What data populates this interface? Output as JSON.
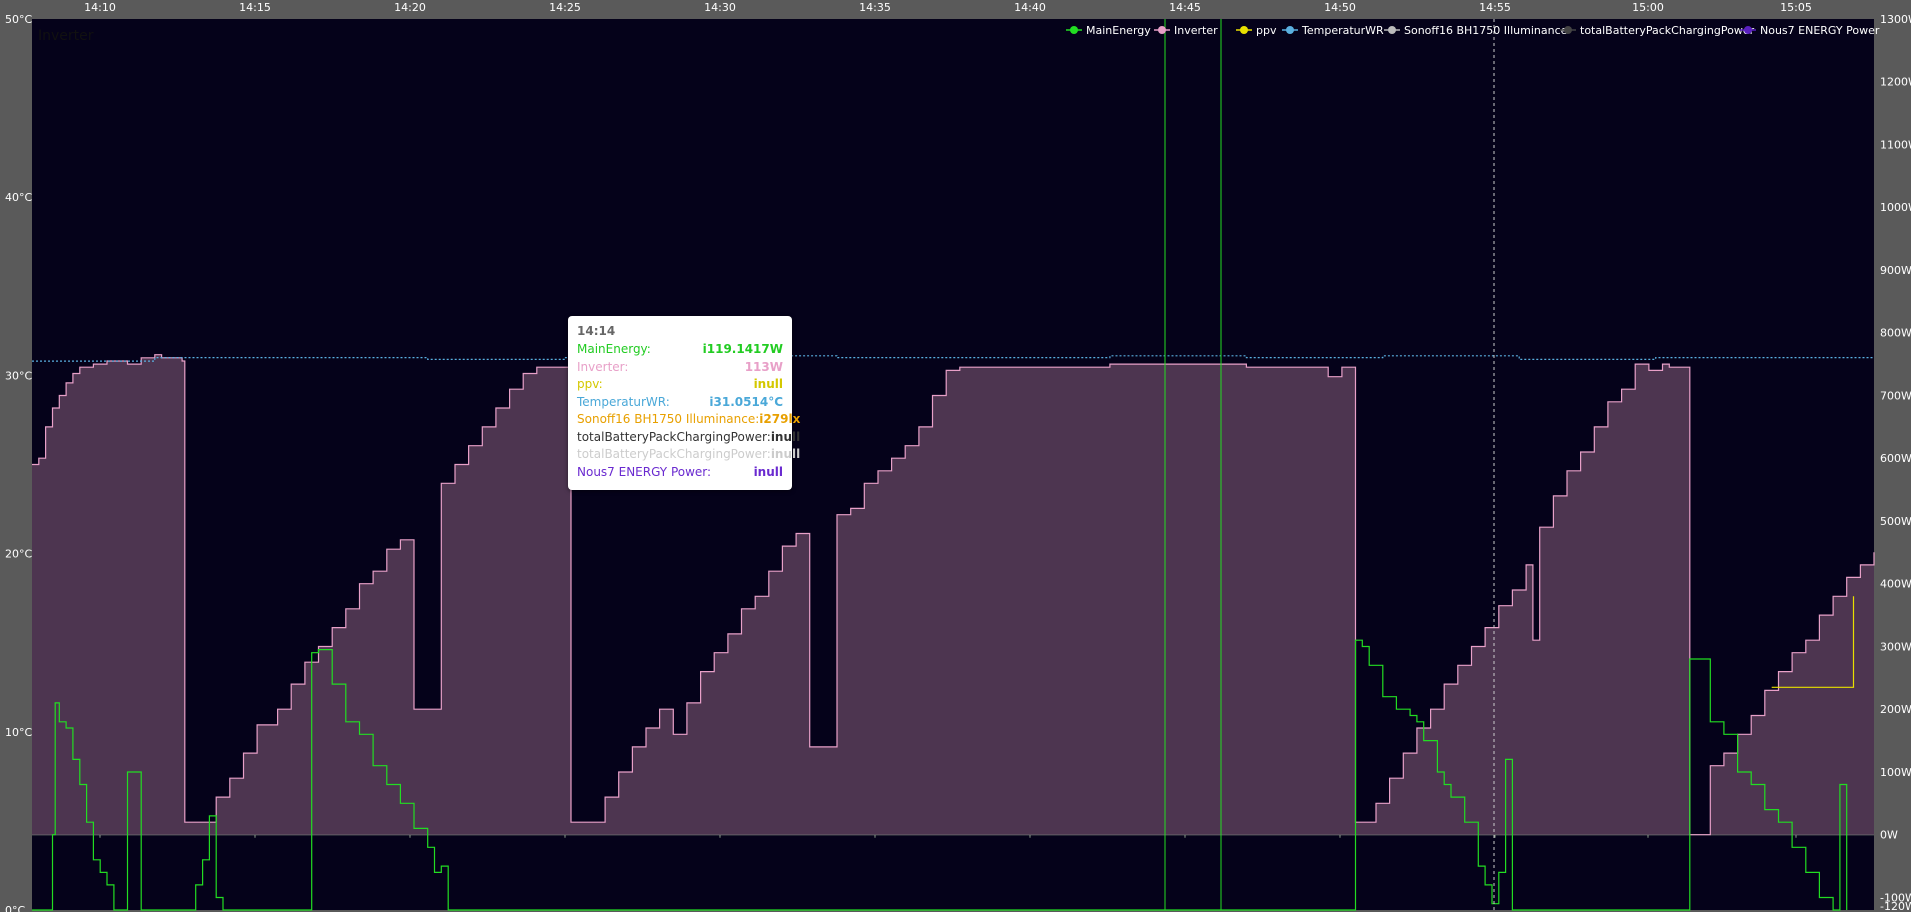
{
  "chart_data": {
    "type": "line",
    "x_ticks": [
      "14:10",
      "14:15",
      "14:20",
      "14:25",
      "14:30",
      "14:35",
      "14:40",
      "14:45",
      "14:50",
      "14:55",
      "15:00",
      "15:05"
    ],
    "y_left_ticks": [
      "50°C",
      "40°C",
      "30°C",
      "20°C",
      "10°C",
      "0°C"
    ],
    "y_left_range": [
      0,
      50
    ],
    "y_right_ticks": [
      "1300W",
      "1200W",
      "1100W",
      "1000W",
      "900W",
      "800W",
      "700W",
      "600W",
      "500W",
      "400W",
      "300W",
      "200W",
      "100W",
      "0W",
      "-100W",
      "-120W"
    ],
    "y_right_range": [
      -120,
      1300
    ],
    "top_left_label": "Inverter",
    "legend": {
      "placement": "top-right",
      "items": [
        {
          "name": "MainEnergy",
          "color": "#22dd22"
        },
        {
          "name": "Inverter",
          "color": "#e8a0c8"
        },
        {
          "name": "ppv",
          "color": "#e8e000"
        },
        {
          "name": "TemperaturWR",
          "color": "#5ab0e0"
        },
        {
          "name": "Sonoff16 BH1750  Illuminance",
          "color": "#bbbbbb"
        },
        {
          "name": "totalBatteryPackChargingPower",
          "color": "#444444"
        },
        {
          "name": "Nous7 ENERGY  Power",
          "color": "#5a20c0"
        }
      ]
    },
    "series": [
      {
        "name": "Inverter",
        "axis": "right",
        "color": "#e8a0c8",
        "fill": "#4d3550",
        "points": [
          [
            14.1,
            590
          ],
          [
            14.15,
            600
          ],
          [
            14.2,
            650
          ],
          [
            14.25,
            680
          ],
          [
            14.3,
            700
          ],
          [
            14.35,
            720
          ],
          [
            14.4,
            735
          ],
          [
            14.45,
            745
          ],
          [
            14.55,
            750
          ],
          [
            14.65,
            755
          ],
          [
            14.72,
            755
          ],
          [
            14.8,
            750
          ],
          [
            14.9,
            760
          ],
          [
            15.0,
            765
          ],
          [
            15.05,
            760
          ],
          [
            15.12,
            760
          ],
          [
            15.2,
            755
          ],
          [
            15.22,
            20
          ],
          [
            15.35,
            20
          ],
          [
            15.45,
            60
          ],
          [
            15.55,
            90
          ],
          [
            15.65,
            130
          ],
          [
            15.75,
            175
          ],
          [
            15.9,
            200
          ],
          [
            16.0,
            240
          ],
          [
            16.1,
            275
          ],
          [
            16.2,
            300
          ],
          [
            16.3,
            330
          ],
          [
            16.4,
            360
          ],
          [
            16.5,
            400
          ],
          [
            16.6,
            420
          ],
          [
            16.7,
            455
          ],
          [
            16.8,
            470
          ],
          [
            16.9,
            200
          ],
          [
            17.0,
            200
          ],
          [
            17.05,
            200
          ],
          [
            17.1,
            560
          ],
          [
            17.2,
            590
          ],
          [
            17.3,
            620
          ],
          [
            17.4,
            650
          ],
          [
            17.5,
            680
          ],
          [
            17.6,
            710
          ],
          [
            17.7,
            735
          ],
          [
            17.8,
            745
          ],
          [
            17.9,
            745
          ],
          [
            17.95,
            745
          ],
          [
            18.0,
            745
          ],
          [
            18.05,
            20
          ],
          [
            18.2,
            20
          ],
          [
            18.3,
            60
          ],
          [
            18.4,
            100
          ],
          [
            18.5,
            140
          ],
          [
            18.6,
            170
          ],
          [
            18.7,
            200
          ],
          [
            18.8,
            160
          ],
          [
            18.9,
            210
          ],
          [
            19.0,
            260
          ],
          [
            19.1,
            290
          ],
          [
            19.2,
            320
          ],
          [
            19.3,
            360
          ],
          [
            19.4,
            380
          ],
          [
            19.5,
            420
          ],
          [
            19.6,
            460
          ],
          [
            19.7,
            480
          ],
          [
            19.8,
            140
          ],
          [
            19.9,
            140
          ],
          [
            19.95,
            140
          ],
          [
            20.0,
            510
          ],
          [
            20.1,
            520
          ],
          [
            20.2,
            560
          ],
          [
            20.3,
            580
          ],
          [
            20.4,
            600
          ],
          [
            20.5,
            620
          ],
          [
            20.6,
            650
          ],
          [
            20.7,
            700
          ],
          [
            20.8,
            740
          ],
          [
            20.9,
            745
          ],
          [
            21.0,
            745
          ],
          [
            21.5,
            745
          ],
          [
            22.0,
            750
          ],
          [
            22.5,
            750
          ],
          [
            23.0,
            745
          ],
          [
            23.3,
            745
          ],
          [
            23.5,
            745
          ],
          [
            23.6,
            730
          ],
          [
            23.7,
            745
          ],
          [
            23.75,
            745
          ],
          [
            23.8,
            20
          ],
          [
            23.95,
            50
          ],
          [
            24.05,
            90
          ],
          [
            24.15,
            130
          ],
          [
            24.25,
            170
          ],
          [
            24.35,
            200
          ],
          [
            24.45,
            240
          ],
          [
            24.55,
            270
          ],
          [
            24.65,
            300
          ],
          [
            24.75,
            330
          ],
          [
            24.85,
            365
          ],
          [
            24.95,
            390
          ],
          [
            25.05,
            430
          ],
          [
            25.1,
            310
          ],
          [
            25.15,
            490
          ],
          [
            25.25,
            540
          ],
          [
            25.35,
            580
          ],
          [
            25.45,
            610
          ],
          [
            25.55,
            650
          ],
          [
            25.65,
            690
          ],
          [
            25.75,
            710
          ],
          [
            25.85,
            750
          ],
          [
            25.95,
            740
          ],
          [
            26.05,
            750
          ],
          [
            26.1,
            745
          ],
          [
            26.2,
            745
          ],
          [
            26.25,
            0
          ],
          [
            26.35,
            0
          ],
          [
            26.4,
            110
          ],
          [
            26.5,
            130
          ],
          [
            26.6,
            160
          ],
          [
            26.7,
            190
          ],
          [
            26.8,
            230
          ],
          [
            26.9,
            260
          ],
          [
            27.0,
            290
          ],
          [
            27.1,
            310
          ],
          [
            27.2,
            350
          ],
          [
            27.3,
            380
          ],
          [
            27.4,
            410
          ],
          [
            27.5,
            430
          ],
          [
            27.6,
            450
          ]
        ]
      },
      {
        "name": "MainEnergy",
        "axis": "right",
        "color": "#22dd22",
        "points": [
          [
            14.1,
            -120
          ],
          [
            14.25,
            0
          ],
          [
            14.27,
            210
          ],
          [
            14.3,
            180
          ],
          [
            14.35,
            170
          ],
          [
            14.4,
            120
          ],
          [
            14.45,
            80
          ],
          [
            14.5,
            20
          ],
          [
            14.55,
            -40
          ],
          [
            14.6,
            -60
          ],
          [
            14.65,
            -80
          ],
          [
            14.7,
            -120
          ],
          [
            14.75,
            -120
          ],
          [
            14.8,
            100
          ],
          [
            14.85,
            100
          ],
          [
            14.9,
            -120
          ],
          [
            15.0,
            -120
          ],
          [
            15.22,
            -120
          ],
          [
            15.3,
            -80
          ],
          [
            15.35,
            -40
          ],
          [
            15.4,
            30
          ],
          [
            15.45,
            -100
          ],
          [
            15.5,
            -120
          ],
          [
            15.6,
            -120
          ],
          [
            16.0,
            -120
          ],
          [
            16.05,
            -120
          ],
          [
            16.06,
            -120
          ],
          [
            16.15,
            290
          ],
          [
            16.2,
            295
          ],
          [
            16.3,
            240
          ],
          [
            16.4,
            180
          ],
          [
            16.5,
            160
          ],
          [
            16.6,
            110
          ],
          [
            16.7,
            80
          ],
          [
            16.8,
            50
          ],
          [
            16.9,
            10
          ],
          [
            17.0,
            -20
          ],
          [
            17.05,
            -60
          ],
          [
            17.1,
            -50
          ],
          [
            17.15,
            -120
          ],
          [
            17.2,
            -120
          ],
          [
            18.0,
            -120
          ],
          [
            18.05,
            -120
          ],
          [
            19.5,
            -120
          ],
          [
            19.55,
            -120
          ],
          [
            19.6,
            -120
          ],
          [
            19.65,
            -120
          ],
          [
            20.0,
            -120
          ],
          [
            23.75,
            -120
          ],
          [
            23.8,
            310
          ],
          [
            23.85,
            300
          ],
          [
            23.9,
            270
          ],
          [
            24.0,
            220
          ],
          [
            24.1,
            200
          ],
          [
            24.2,
            190
          ],
          [
            24.25,
            180
          ],
          [
            24.3,
            150
          ],
          [
            24.4,
            100
          ],
          [
            24.45,
            80
          ],
          [
            24.5,
            60
          ],
          [
            24.6,
            20
          ],
          [
            24.7,
            -50
          ],
          [
            24.75,
            -80
          ],
          [
            24.8,
            -110
          ],
          [
            24.85,
            -60
          ],
          [
            24.9,
            120
          ],
          [
            24.95,
            -120
          ],
          [
            25.0,
            -120
          ],
          [
            25.1,
            -120
          ],
          [
            26.2,
            -120
          ],
          [
            26.25,
            280
          ],
          [
            26.35,
            280
          ],
          [
            26.4,
            180
          ],
          [
            26.5,
            160
          ],
          [
            26.6,
            100
          ],
          [
            26.7,
            80
          ],
          [
            26.8,
            40
          ],
          [
            26.9,
            20
          ],
          [
            27.0,
            -20
          ],
          [
            27.1,
            -60
          ],
          [
            27.2,
            -100
          ],
          [
            27.3,
            -120
          ],
          [
            27.35,
            80
          ],
          [
            27.4,
            -120
          ]
        ]
      },
      {
        "name": "TemperaturWR",
        "axis": "left",
        "color": "#5ab0e0",
        "dashed": true,
        "points": [
          [
            14.1,
            30.8
          ],
          [
            15.0,
            31.0
          ],
          [
            16.0,
            31.0
          ],
          [
            17.0,
            30.9
          ],
          [
            18.0,
            31.0
          ],
          [
            19.0,
            31.1
          ],
          [
            20.0,
            31.0
          ],
          [
            21.0,
            31.0
          ],
          [
            22.0,
            31.1
          ],
          [
            23.0,
            31.0
          ],
          [
            24.0,
            31.1
          ],
          [
            25.0,
            30.9
          ],
          [
            26.0,
            31.0
          ],
          [
            27.0,
            31.0
          ],
          [
            27.6,
            31.0
          ]
        ]
      },
      {
        "name": "ppv",
        "axis": "right",
        "color": "#e8e000",
        "points": [
          [
            26.85,
            235
          ],
          [
            27.35,
            235
          ],
          [
            27.45,
            380
          ]
        ]
      }
    ],
    "events": [
      {
        "x": 14.45,
        "color": "#22dd22"
      },
      {
        "x": 14.48,
        "color": "#22dd22"
      },
      {
        "x": 14.55,
        "color": "#cccccc",
        "dashed": true
      }
    ]
  },
  "tooltip": {
    "title": "14:14",
    "rows": [
      {
        "label": "MainEnergy:",
        "value": "i119.1417W",
        "color": "#22cc22"
      },
      {
        "label": "Inverter:",
        "value": "113W",
        "color": "#e8a0c8"
      },
      {
        "label": "ppv:",
        "value": "inull",
        "color": "#d4c800"
      },
      {
        "label": "TemperaturWR:",
        "value": "i31.0514°C",
        "color": "#4aa8d8"
      },
      {
        "label": "Sonoff16 BH1750 Illuminance:",
        "value": "i279lx",
        "color": "#e8a000"
      },
      {
        "label": "totalBatteryPackChargingPower:",
        "value": "inull",
        "color": "#333333"
      },
      {
        "label": "totalBatteryPackChargingPower:",
        "value": "inull",
        "color": "#cccccc"
      },
      {
        "label": "Nous7 ENERGY Power:",
        "value": "inull",
        "color": "#6a2ad0"
      }
    ]
  }
}
